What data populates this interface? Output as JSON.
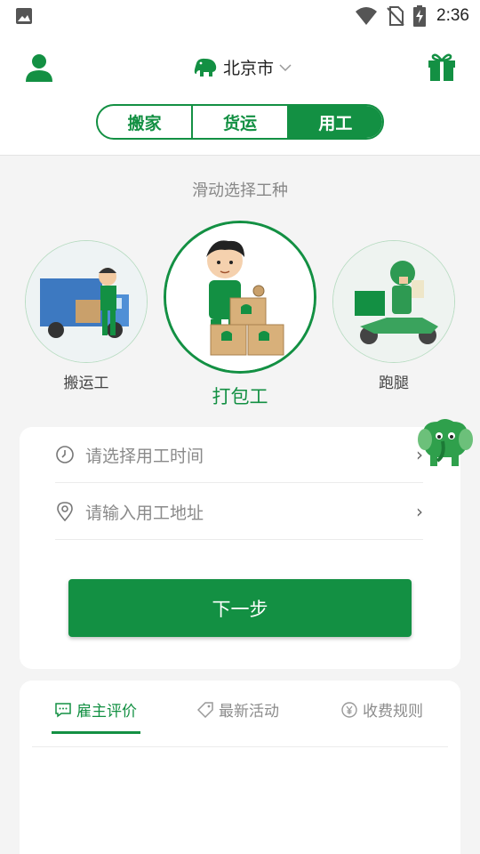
{
  "status_bar": {
    "time": "2:36"
  },
  "header": {
    "city": "北京市",
    "segments": [
      {
        "label": "搬家",
        "active": false
      },
      {
        "label": "货运",
        "active": false
      },
      {
        "label": "用工",
        "active": true
      }
    ]
  },
  "selector": {
    "hint": "滑动选择工种",
    "workers": [
      {
        "label": "搬运工"
      },
      {
        "label": "打包工",
        "selected": true
      },
      {
        "label": "跑腿"
      }
    ]
  },
  "form": {
    "time_placeholder": "请选择用工时间",
    "address_placeholder": "请输入用工地址",
    "next_label": "下一步"
  },
  "tabs": [
    {
      "label": "雇主评价",
      "active": true
    },
    {
      "label": "最新活动"
    },
    {
      "label": "收费规则"
    }
  ],
  "colors": {
    "brand": "#139043",
    "background": "#f4f4f4"
  },
  "icons": [
    "image-icon",
    "wifi-icon",
    "no-sim-icon",
    "battery-charging-icon",
    "user-icon",
    "elephant-logo-icon",
    "chevron-down-icon",
    "gift-icon",
    "clock-icon",
    "location-pin-icon",
    "chevron-right-icon",
    "comment-icon",
    "tag-icon",
    "yuan-icon"
  ]
}
